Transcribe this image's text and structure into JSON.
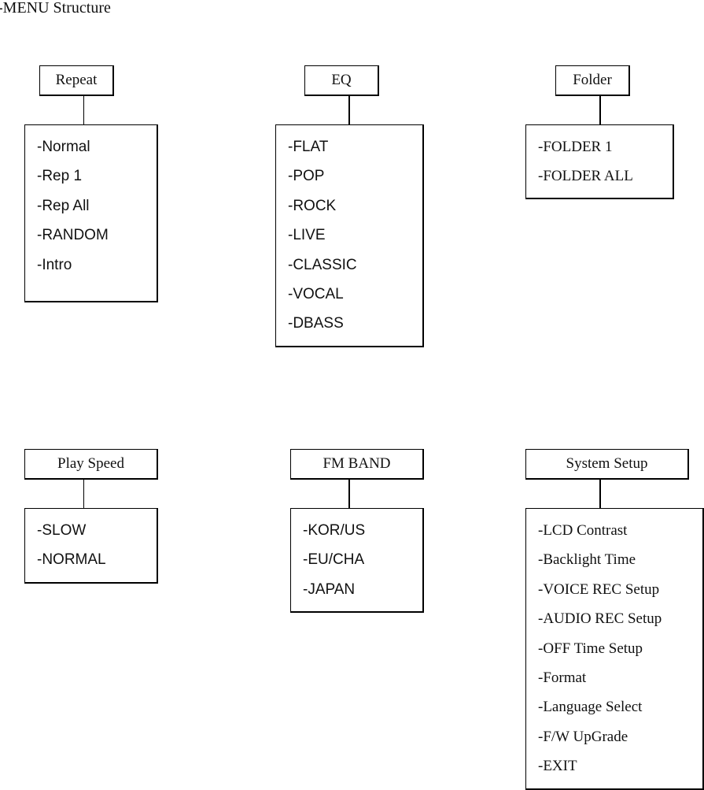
{
  "title": "-MENU Structure",
  "menus": [
    {
      "label": "Repeat",
      "items": [
        "-Normal",
        "-Rep 1",
        "-Rep All",
        "-RANDOM",
        "-Intro"
      ]
    },
    {
      "label": "EQ",
      "items": [
        "-FLAT",
        "-POP",
        "-ROCK",
        "-LIVE",
        "-CLASSIC",
        "-VOCAL",
        "-DBASS"
      ]
    },
    {
      "label": "Folder",
      "items": [
        "-FOLDER 1",
        "-FOLDER ALL"
      ]
    },
    {
      "label": "Play Speed",
      "items": [
        "-SLOW",
        "-NORMAL"
      ]
    },
    {
      "label": "FM BAND",
      "items": [
        "-KOR/US",
        "-EU/CHA",
        "-JAPAN"
      ]
    },
    {
      "label": "System Setup",
      "items": [
        "-LCD Contrast",
        "-Backlight Time",
        "-VOICE REC Setup",
        "-AUDIO REC Setup",
        "-OFF Time Setup",
        "-Format",
        "-Language Select",
        "-F/W UpGrade",
        "-EXIT"
      ]
    }
  ]
}
